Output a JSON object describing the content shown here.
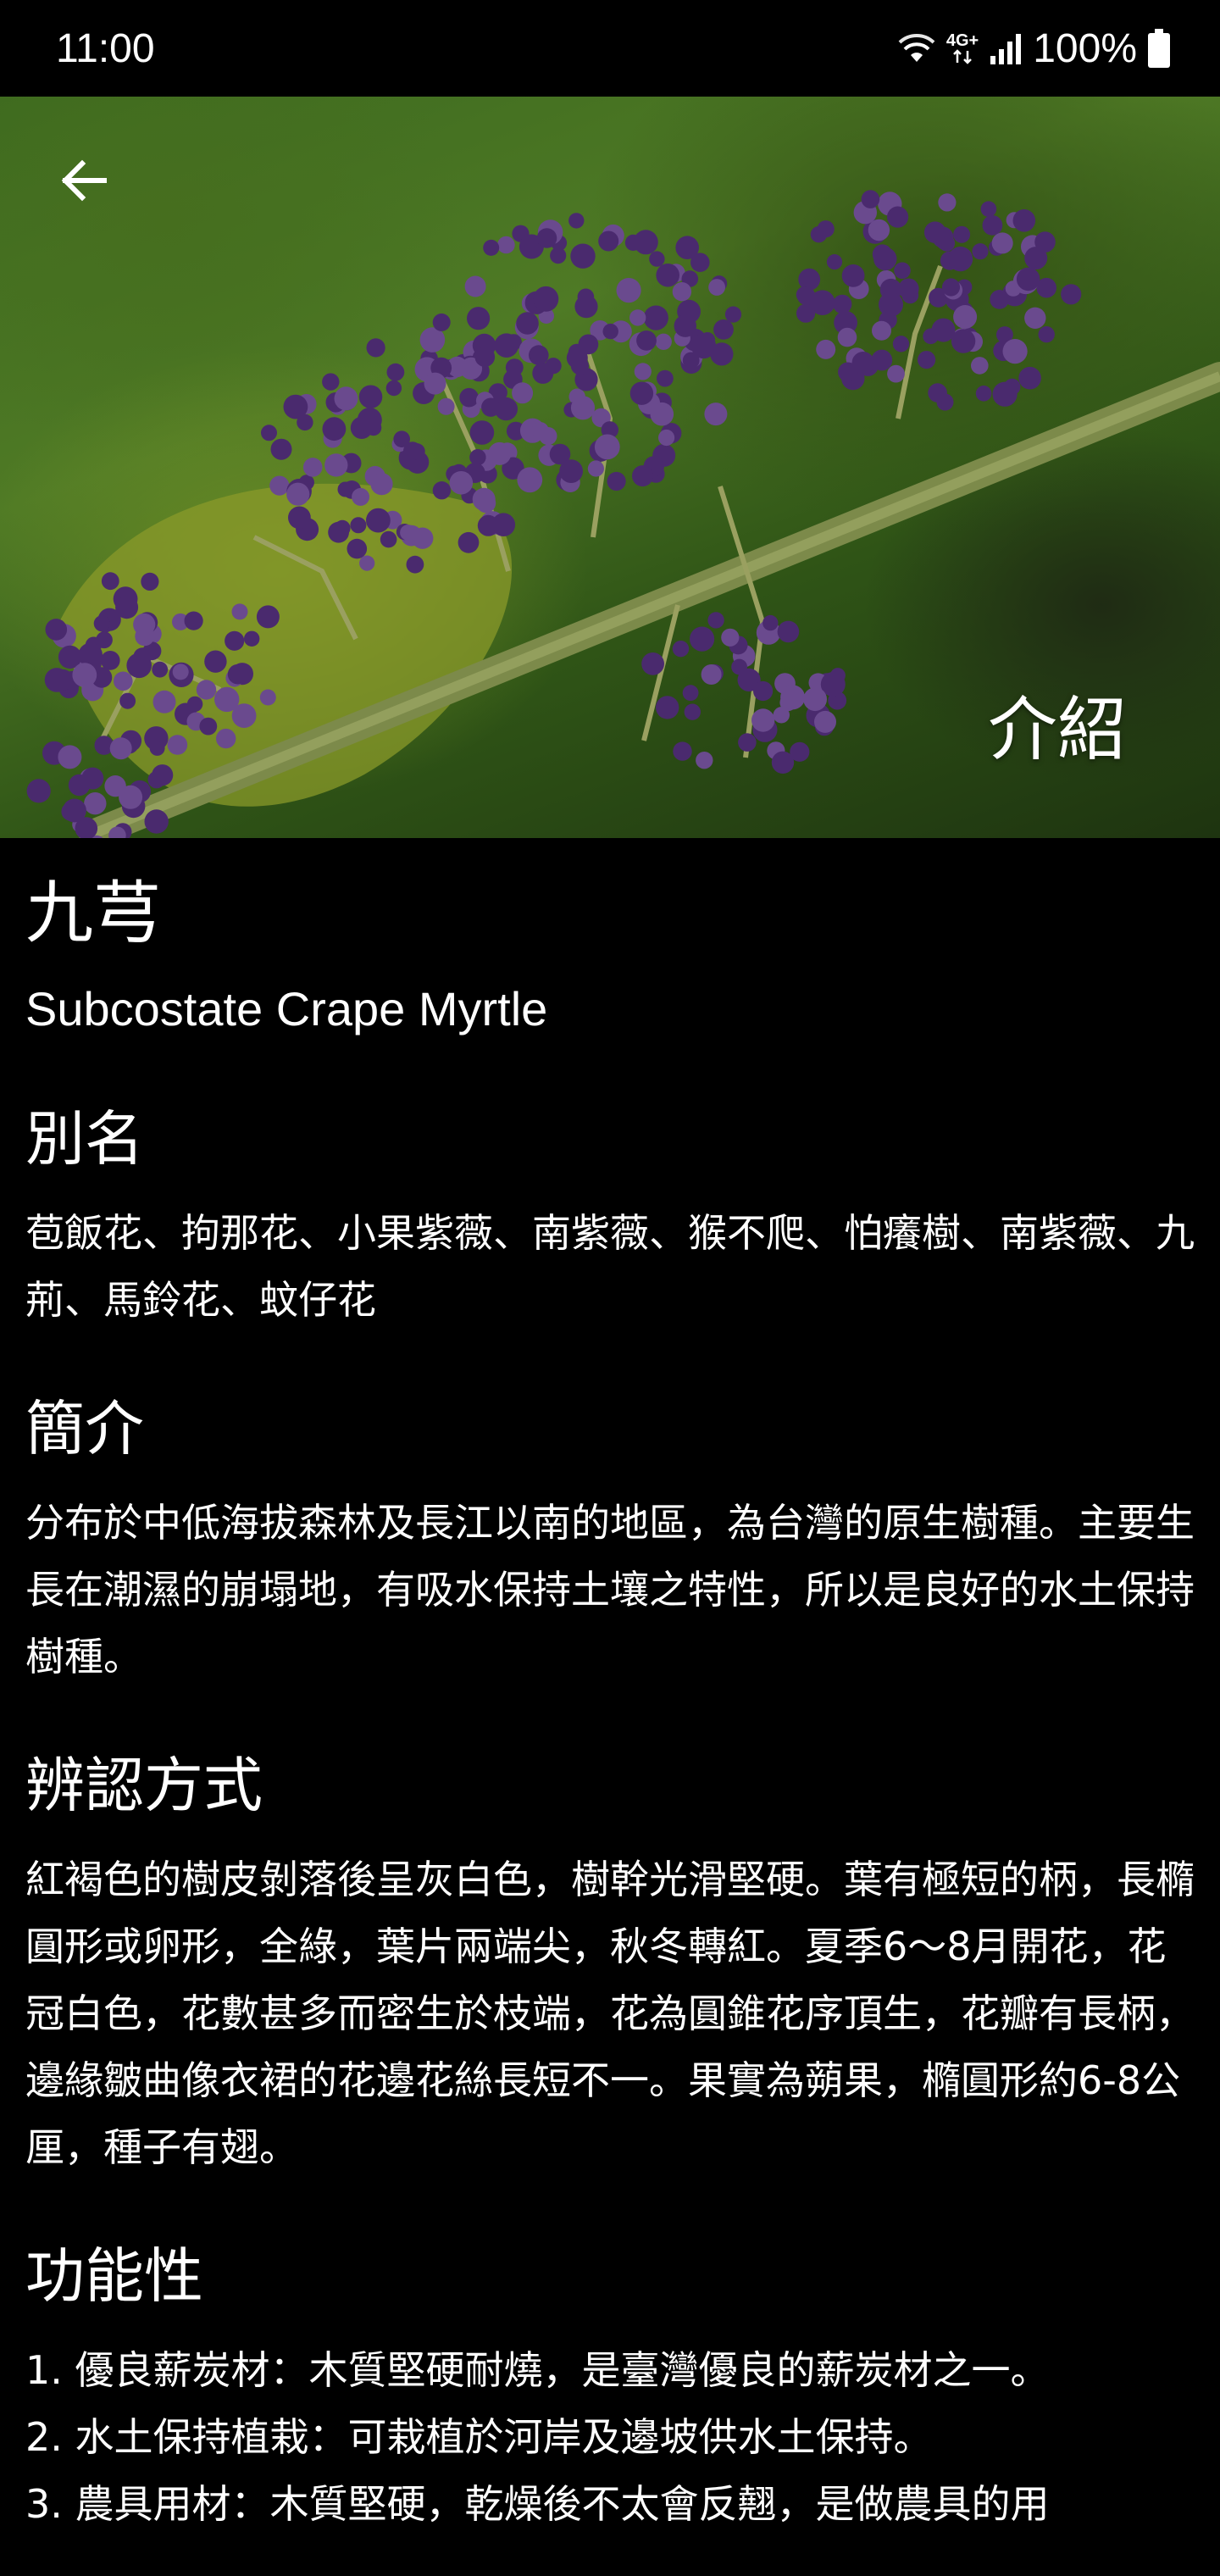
{
  "status_bar": {
    "time": "11:00",
    "network_label": "4G+",
    "battery": "100%"
  },
  "header": {
    "back_icon": "arrow-left-icon",
    "title": "介紹"
  },
  "plant": {
    "name": "九芎",
    "english_name": "Subcostate Crape Myrtle"
  },
  "sections": {
    "alias": {
      "title": "別名",
      "body": "苞飯花、拘那花、小果紫薇、南紫薇、猴不爬、怕癢樹、南紫薇、九荊、馬鈴花、蚊仔花"
    },
    "intro": {
      "title": "簡介",
      "body": "分布於中低海拔森林及長江以南的地區，為台灣的原生樹種。主要生長在潮濕的崩塌地，有吸水保持土壤之特性，所以是良好的水土保持樹種。"
    },
    "identify": {
      "title": "辨認方式",
      "body": "紅褐色的樹皮剝落後呈灰白色，樹幹光滑堅硬。葉有極短的柄，長橢圓形或卵形，全綠，葉片兩端尖，秋冬轉紅。夏季6～8月開花，花冠白色，花數甚多而密生於枝端，花為圓錐花序頂生，花瓣有長柄，邊緣皺曲像衣裙的花邊花絲長短不一。果實為蒴果，橢圓形約6-8公厘，種子有翅。"
    },
    "function": {
      "title": "功能性",
      "items": [
        "1. 優良薪炭材：木質堅硬耐燒，是臺灣優良的薪炭材之一。",
        "2. 水土保持植栽：可栽植於河岸及邊坡供水土保持。",
        "3. 農具用材：木質堅硬，乾燥後不太會反翹，是做農具的用"
      ]
    }
  },
  "colors": {
    "background": "#000000",
    "text": "#ffffff",
    "berry": "#4a2a6e"
  }
}
